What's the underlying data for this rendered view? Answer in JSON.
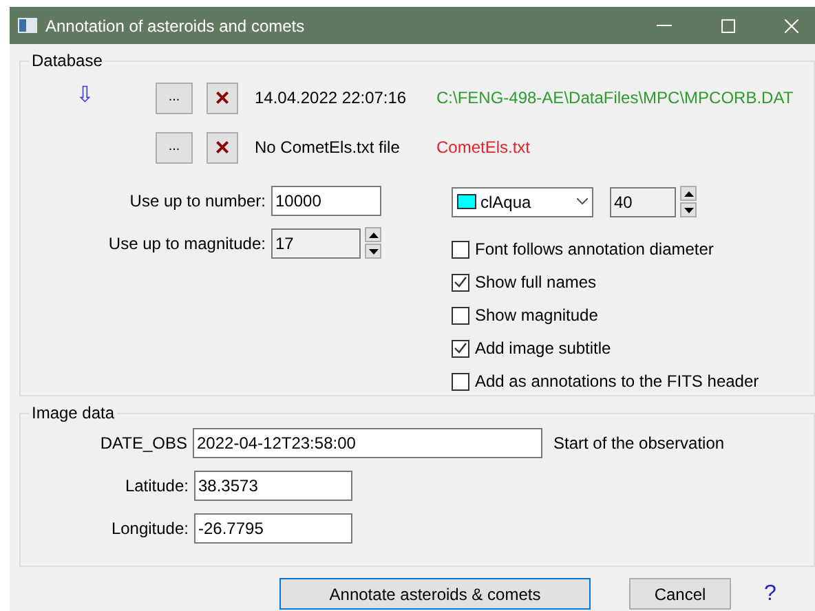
{
  "window": {
    "title": "Annotation of asteroids and comets"
  },
  "database": {
    "title": "Database",
    "arrow": "⇩",
    "files": [
      {
        "browse": "...",
        "clear": "×",
        "status": "14.04.2022 22:07:16",
        "path": "C:\\FENG-498-AE\\DataFiles\\MPC\\MPCORB.DAT",
        "found": true
      },
      {
        "browse": "...",
        "clear": "×",
        "status": "No CometEls.txt file",
        "path": "CometEls.txt",
        "found": false
      }
    ],
    "number": {
      "label": "Use up to number:",
      "value": "10000"
    },
    "magnitude": {
      "label": "Use up to magnitude:",
      "value": "17"
    },
    "color": {
      "value": "clAqua",
      "color": "#00ffff"
    },
    "size": {
      "value": "40"
    },
    "options": [
      {
        "label": "Font follows annotation diameter",
        "checked": false
      },
      {
        "label": "Show full names",
        "checked": true
      },
      {
        "label": "Show magnitude",
        "checked": false
      },
      {
        "label": "Add image subtitle",
        "checked": true
      },
      {
        "label": "Add as annotations to the FITS header",
        "checked": false
      }
    ]
  },
  "image_data": {
    "title": "Image data",
    "date_obs": {
      "label": "DATE_OBS",
      "value": "2022-04-12T23:58:00",
      "hint": "Start of the observation"
    },
    "latitude": {
      "label": "Latitude:",
      "value": "38.3573"
    },
    "longitude": {
      "label": "Longitude:",
      "value": "-26.7795"
    }
  },
  "buttons": {
    "annotate": "Annotate asteroids & comets",
    "cancel": "Cancel",
    "help": "?"
  }
}
